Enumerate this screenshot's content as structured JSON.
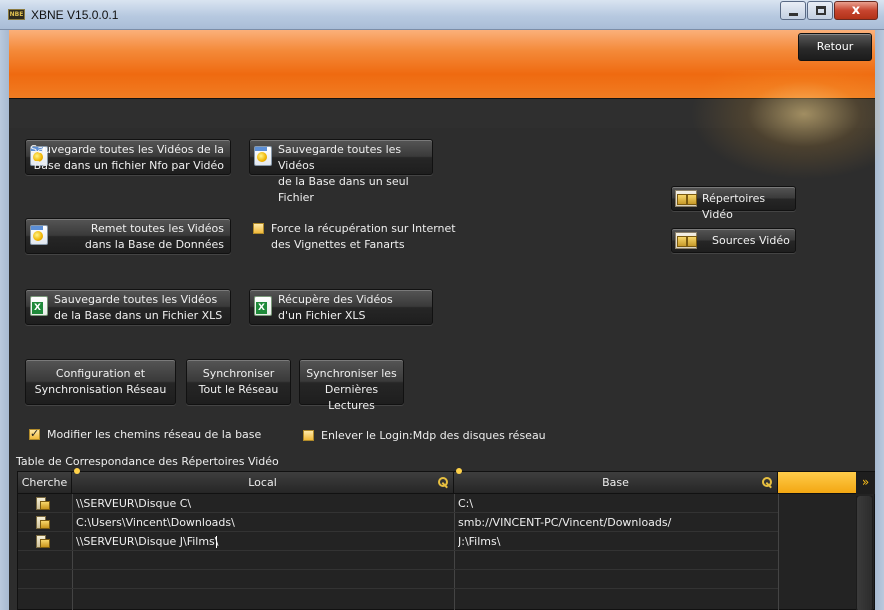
{
  "window": {
    "title": "XBNE V15.0.0.1",
    "app_icon_text": "NBE",
    "close_glyph": "x"
  },
  "header": {
    "retour_label": "Retour"
  },
  "buttons": {
    "save_nfo": "Sauvegarde toutes les Vidéos de la\nBase dans un fichier Nfo par Vidéo",
    "save_single": "Sauvegarde toutes les Vidéos\nde la Base dans un seul Fichier",
    "restore_db": "Remet toutes les Vidéos\ndans la Base de Données",
    "save_xls": "Sauvegarde toutes les Vidéos\nde la Base dans un Fichier XLS",
    "load_xls": "Récupère des Vidéos\nd'un Fichier XLS",
    "config_sync": "Configuration et\nSynchronisation Réseau",
    "sync_all": "Synchroniser\nTout le Réseau",
    "sync_last": "Synchroniser les\nDernières Lectures",
    "video_dirs": "Répertoires Vidéo",
    "video_sources": "Sources Vidéo"
  },
  "options": {
    "force_fetch": {
      "label": "Force la récupération sur Internet\ndes Vignettes et Fanarts",
      "checked": false
    },
    "modify_paths": {
      "label": "Modifier les chemins réseau de la base",
      "checked": true
    },
    "remove_login": {
      "label": "Enlever le Login:Mdp des disques réseau",
      "checked": false
    }
  },
  "table": {
    "caption": "Table de Correspondance des Répertoires Vidéo",
    "columns": {
      "search": "Cherche",
      "local": "Local",
      "base": "Base"
    },
    "scroll_glyph": "»",
    "rows": [
      {
        "local": "\\\\SERVEUR\\Disque C\\",
        "base": "C:\\"
      },
      {
        "local": "C:\\Users\\Vincent\\Downloads\\",
        "base": "smb://VINCENT-PC/Vincent/Downloads/"
      },
      {
        "local": "\\\\SERVEUR\\Disque J\\Films\\",
        "base": "J:\\Films\\"
      }
    ]
  },
  "colors": {
    "accent_orange": "#ef6a10",
    "checkbox_yellow": "#f0b93a",
    "panel_dark": "#2d2d2d"
  }
}
